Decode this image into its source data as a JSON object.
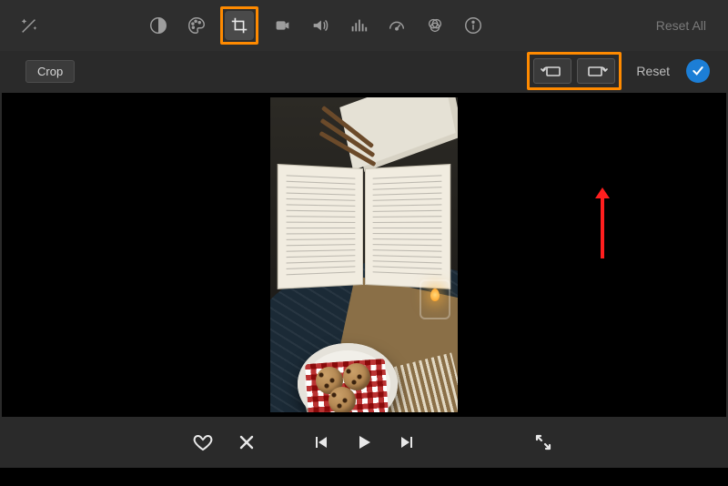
{
  "toolbar": {
    "reset_all": "Reset All",
    "icons": {
      "magic": "magic-wand-icon",
      "contrast": "contrast-icon",
      "palette": "palette-icon",
      "crop": "crop-icon",
      "video": "video-stabilize-icon",
      "volume": "volume-icon",
      "equalizer": "equalizer-icon",
      "speed": "speedometer-icon",
      "color_filter": "color-circles-icon",
      "info": "info-icon"
    }
  },
  "subbar": {
    "crop_label": "Crop",
    "reset_label": "Reset"
  },
  "controls": {
    "favorite": "favorite",
    "reject": "reject",
    "prev": "previous",
    "play": "play",
    "next": "next",
    "fullscreen": "fullscreen"
  },
  "annotations": {
    "crop_highlight": true,
    "rotate_highlight": true,
    "arrow_to_rotate": true
  }
}
